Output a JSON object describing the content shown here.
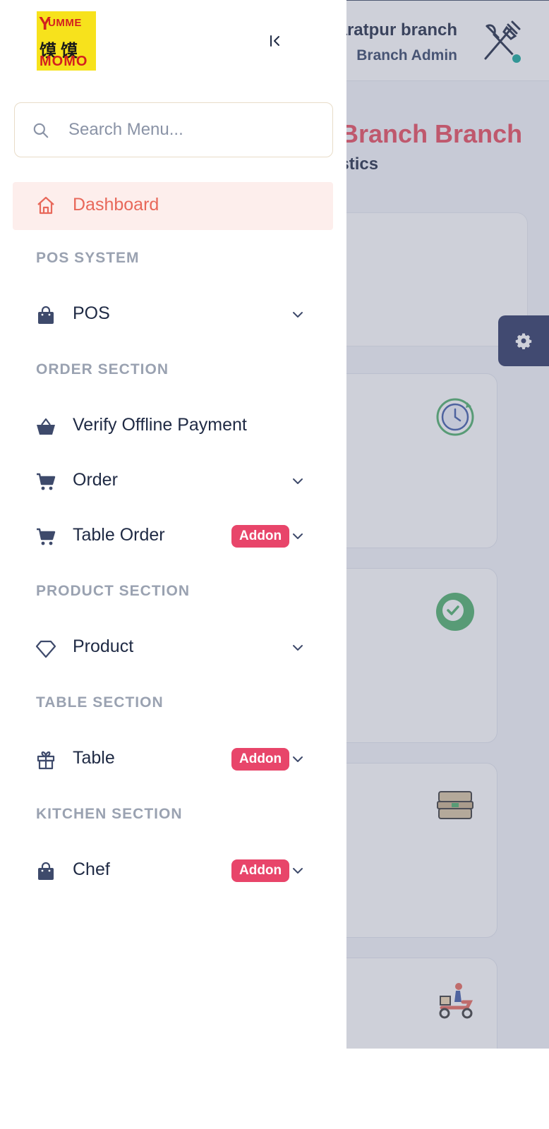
{
  "header": {
    "branch_name": "Bharatpur branch",
    "branch_role": "Branch Admin",
    "avatar_icon": "fork-knife-icon",
    "status_color": "#13a89a"
  },
  "main": {
    "title": "Bharatpur Branch Branch",
    "subtitle": "Dashboard statistics",
    "stat_icons": [
      "clock-icon",
      "check-circle-icon",
      "food-box-icon",
      "delivery-scooter-icon"
    ]
  },
  "logo": {
    "line1": "UMME",
    "y": "Y",
    "line2": "馍馍",
    "line3": "MOMO"
  },
  "search": {
    "placeholder": "Search Menu..."
  },
  "nav": {
    "dashboard": "Dashboard",
    "sections": {
      "pos": "POS SYSTEM",
      "order": "ORDER SECTION",
      "product": "PRODUCT SECTION",
      "table": "TABLE SECTION",
      "kitchen": "KITCHEN SECTION"
    },
    "items": {
      "pos": "POS",
      "verify_payment": "Verify Offline Payment",
      "order": "Order",
      "table_order": "Table Order",
      "product": "Product",
      "table": "Table",
      "chef": "Chef"
    },
    "addon_label": "Addon"
  },
  "colors": {
    "accent": "#e8685a",
    "active_bg": "#fdeeec",
    "addon_badge": "#e8456a",
    "title_red": "#e8495b",
    "settings_bg": "#2a3462"
  }
}
